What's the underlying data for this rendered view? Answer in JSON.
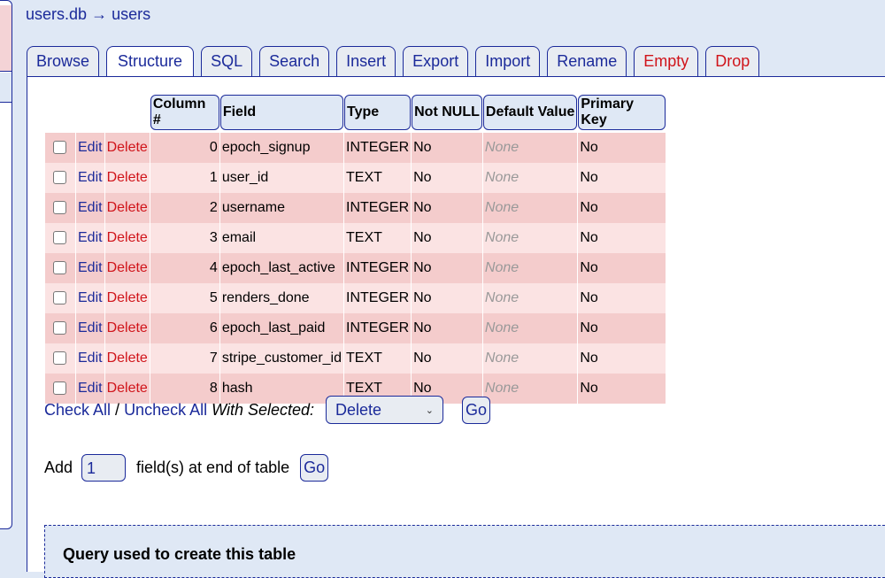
{
  "breadcrumb": {
    "db": "users.db",
    "arrow": "→",
    "table": "users"
  },
  "tabs": [
    "Browse",
    "Structure",
    "SQL",
    "Search",
    "Insert",
    "Export",
    "Import",
    "Rename",
    "Empty",
    "Drop"
  ],
  "active_tab": "Structure",
  "columns": [
    "Column #",
    "Field",
    "Type",
    "Not NULL",
    "Default Value",
    "Primary Key"
  ],
  "row_actions": {
    "edit": "Edit",
    "delete": "Delete"
  },
  "rows": [
    {
      "num": "0",
      "field": "epoch_signup",
      "type": "INTEGER",
      "notnull": "No",
      "default": "None",
      "pk": "No"
    },
    {
      "num": "1",
      "field": "user_id",
      "type": "TEXT",
      "notnull": "No",
      "default": "None",
      "pk": "No"
    },
    {
      "num": "2",
      "field": "username",
      "type": "INTEGER",
      "notnull": "No",
      "default": "None",
      "pk": "No"
    },
    {
      "num": "3",
      "field": "email",
      "type": "TEXT",
      "notnull": "No",
      "default": "None",
      "pk": "No"
    },
    {
      "num": "4",
      "field": "epoch_last_active",
      "type": "INTEGER",
      "notnull": "No",
      "default": "None",
      "pk": "No"
    },
    {
      "num": "5",
      "field": "renders_done",
      "type": "INTEGER",
      "notnull": "No",
      "default": "None",
      "pk": "No"
    },
    {
      "num": "6",
      "field": "epoch_last_paid",
      "type": "INTEGER",
      "notnull": "No",
      "default": "None",
      "pk": "No"
    },
    {
      "num": "7",
      "field": "stripe_customer_id",
      "type": "TEXT",
      "notnull": "No",
      "default": "None",
      "pk": "No"
    },
    {
      "num": "8",
      "field": "hash",
      "type": "TEXT",
      "notnull": "No",
      "default": "None",
      "pk": "No"
    }
  ],
  "bulk": {
    "check_all": "Check All",
    "sep": "/",
    "uncheck_all": "Uncheck All",
    "with_selected": "With Selected:",
    "action": "Delete",
    "go": "Go"
  },
  "add_field": {
    "label": "Add",
    "value": "1",
    "suffix": "field(s) at end of table",
    "go": "Go"
  },
  "query": {
    "title": "Query used to create this table"
  }
}
